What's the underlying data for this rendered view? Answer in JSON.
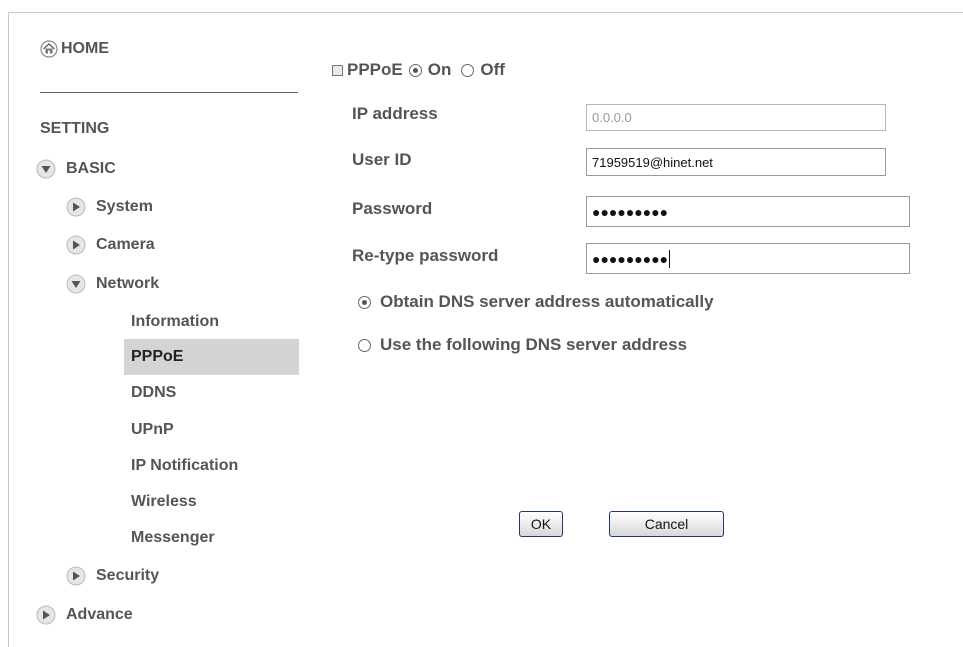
{
  "sidebar": {
    "home_label": "HOME",
    "setting_label": "SETTING",
    "basic_label": "BASIC",
    "system_label": "System",
    "camera_label": "Camera",
    "network_label": "Network",
    "network_items": [
      "Information",
      "PPPoE",
      "DDNS",
      "UPnP",
      "IP Notification",
      "Wireless",
      "Messenger"
    ],
    "active_item": "PPPoE",
    "security_label": "Security",
    "advance_label": "Advance"
  },
  "pppoe": {
    "label": "PPPoE",
    "on_label": "On",
    "off_label": "Off",
    "enabled": true
  },
  "form": {
    "ip_label": "IP address",
    "ip_value": "0.0.0.0",
    "user_label": "User ID",
    "user_value": "71959519@hinet.net",
    "password_label": "Password",
    "password_mask": "●●●●●●●●●",
    "retype_label": "Re-type password",
    "retype_mask": "●●●●●●●●●"
  },
  "dns": {
    "auto_label": "Obtain DNS server address automatically",
    "manual_label": "Use the following DNS server address",
    "selected": "auto"
  },
  "buttons": {
    "ok_label": "OK",
    "cancel_label": "Cancel"
  },
  "colors": {
    "text": "#555555",
    "active_bg": "#d4d4d4",
    "button_border": "#1f3a6b"
  }
}
